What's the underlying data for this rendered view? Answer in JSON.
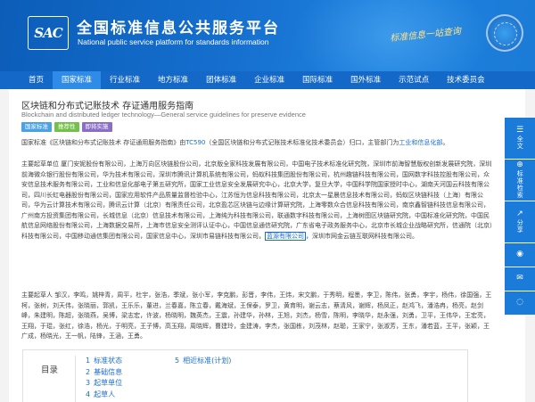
{
  "header": {
    "logo_text": "SAC",
    "title": "全国标准信息公共服务平台",
    "subtitle": "National public service platform  for standards information",
    "slogan": "标准信息一站查询"
  },
  "nav": {
    "items": [
      {
        "label": "首页",
        "active": false
      },
      {
        "label": "国家标准",
        "active": true
      },
      {
        "label": "行业标准",
        "active": false
      },
      {
        "label": "地方标准",
        "active": false
      },
      {
        "label": "团体标准",
        "active": false
      },
      {
        "label": "企业标准",
        "active": false
      },
      {
        "label": "国际标准",
        "active": false
      },
      {
        "label": "国外标准",
        "active": false
      },
      {
        "label": "示范试点",
        "active": false
      },
      {
        "label": "技术委员会",
        "active": false
      }
    ]
  },
  "page": {
    "title": "区块链和分布式记账技术 存证通用服务指南",
    "title_en": "Blockchain and distributed ledger technology—General service guidelines for preserve evidence",
    "tags": [
      "国家标准",
      "推荐性",
      "即将实施"
    ]
  },
  "para1": {
    "prefix": "国家标准《区块链和分布式记账技术 存证通用服务指南》由",
    "tc": "TC590",
    "middle": "（全国区块链和分布式记账技术标准化技术委员会）归口，主管部门为",
    "dept": "工业和信息化部",
    "suffix": "。"
  },
  "para2": {
    "text_before": "主要起草单位 厦门安妮股份有限公司，上海万向区块链股份公司，北京版全家科技发展有限公司，中国电子技术标准化研究院，深圳市前海智慧版权创新发展研究院，深圳前海微众银行股份有限公司，华为技术有限公司，深圳市腾讯计算机系统有限公司，蚂蚁科技集团股份有限公司，杭州趣链科技有限公司，国网数字科技控股有限公司，众安信息技术服务有限公司，工业和信息化部电子第五研究所，国家工业信息安全发展研究中心，北京大学，复旦大学，中国科学院国家授时中心，湖南天河国云科技有限公司，四川长虹电器股份有限公司，国家应用软件产品质量监督检验中心，江苏恒为信息科技有限公司，北京太一星晨信息技术有限公司，蚂蚁区块链科技（上海）有限公司，华为云计算技术有限公司，腾讯云计算（北京）有限责任公司，北京盈芯区块链与边缘计算研究院，上海零数众合信息科技有限公司，南京鑫智链科技信息有限公司，广州南方投资集团有限公司，长城信息（北京）信息技术有限公司，上海纯为科技有限公司，联通数字科技有限公司，上海树图区块链研究院，中国标准化研究院，中国民航信息网络股份有限公司，上海数据交易所，上海市信息安全测评认证中心，中国信息通信研究院，广东省电子政务服务中心，北京市长城企业战略研究所，信通院（北京）科技有限公司，中国移动通信集团有限公司，国家信息中心，深圳市易链科技有限公司，",
    "highlight": "蓝源有限公司",
    "text_after": "，深圳市网金云链互联网科技有限公司。"
  },
  "para3": {
    "text": "主要起草人 邹汉，李鸣，姚梓青，周平，杜宇，张浩，季斌，张小军，李克鹏，彭晋，李伟，王炜，宋文鹏，于秀明，程墨，李卫，陈伟，张勇，李宇，杨伟，徐国强，王柯，张树，刘天伟，张晓丽，郭凯，王乐乐，董进，兰春嘉，陈立春，戴海斌，王保泰，罗卫，黄育明，谢云志，蔡清风，谢辉，杨凤正，赵鸿飞，潘浩冉，杨亮，赵剑峰，朱建明，陈超，张晓燕，吴博，梁志宏，许波，杨晓明，魏英杰，王震，孙建华，孙林，王旭，刘杰，杨雪，陈明，李晓华，赵永强，刘勇，卫平，王伟华，王宏亮，王翔，于琨，张红，徐浩，杨光，于明亮，王子博，高玉翔，周晓辉，曹建玲，金建涛，李杰，张国栋，刘茂林，赵聪，王家宁，张淑芳，王东，潘若蓝，王平，张颖，王广成，杨晓光，王一帆，陆锋，王涵，王勇。"
  },
  "toc": {
    "label": "目录",
    "col1": [
      {
        "num": "1",
        "label": "标准状态"
      },
      {
        "num": "2",
        "label": "基础信息"
      },
      {
        "num": "3",
        "label": "起草单位"
      },
      {
        "num": "4",
        "label": "起草人"
      }
    ],
    "col2": [
      {
        "num": "5",
        "label": "相近标准(计划)"
      }
    ]
  },
  "sidebar": {
    "items": [
      {
        "icon": "full-text-icon",
        "glyph": "☰",
        "label": "全文"
      },
      {
        "icon": "download-icon",
        "glyph": "⊕",
        "label": "标准检索"
      },
      {
        "icon": "share-icon",
        "glyph": "↗",
        "label": "分享"
      },
      {
        "icon": "weibo-icon",
        "glyph": "◉",
        "label": ""
      },
      {
        "icon": "wechat-icon",
        "glyph": "✉",
        "label": ""
      },
      {
        "icon": "qq-icon",
        "glyph": "◌",
        "label": ""
      }
    ]
  },
  "colors": {
    "header_blue": "#1670cf",
    "nav_blue": "#1468c8",
    "nav_active": "#2f8be8",
    "link_blue": "#1a6ed0",
    "tag_blue": "#4aa1e4",
    "tag_green": "#73c14a",
    "tag_purple": "#8a6dc4"
  }
}
